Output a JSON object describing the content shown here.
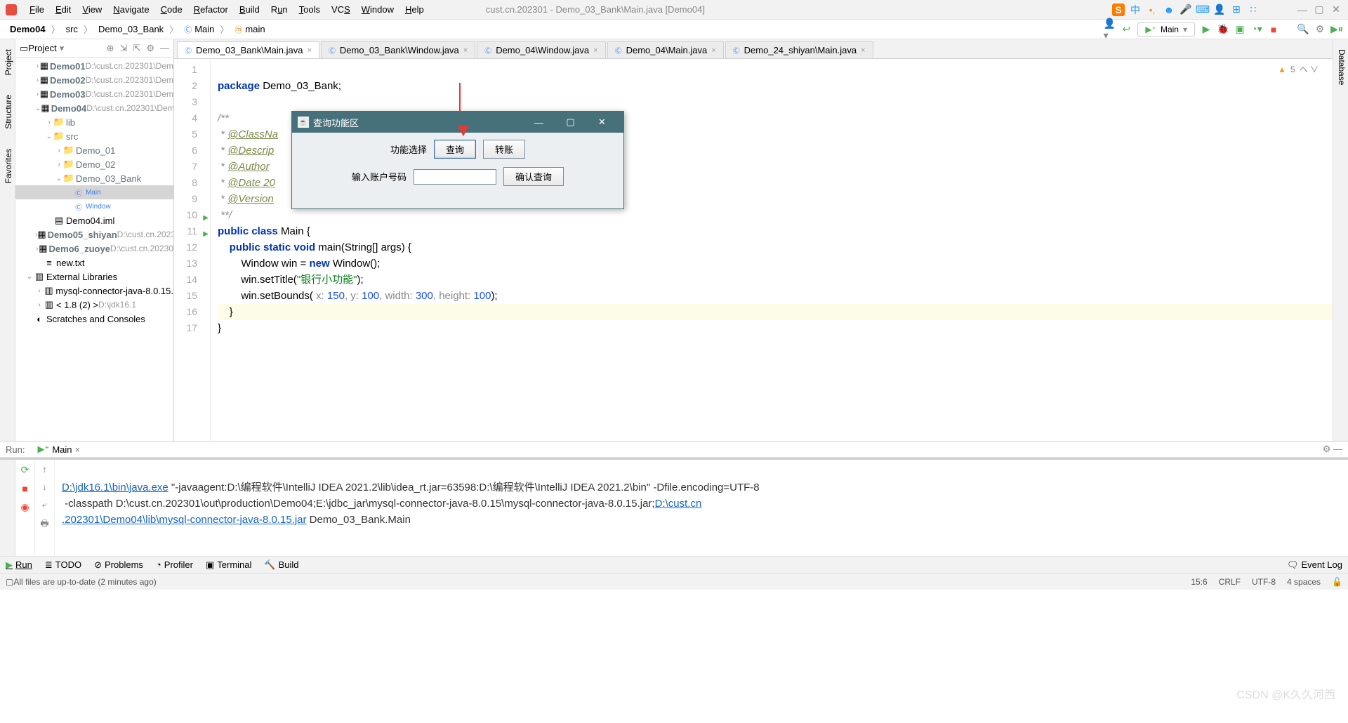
{
  "window": {
    "title": "cust.cn.202301 - Demo_03_Bank\\Main.java [Demo04]"
  },
  "menu": [
    "File",
    "Edit",
    "View",
    "Navigate",
    "Code",
    "Refactor",
    "Build",
    "Run",
    "Tools",
    "VCS",
    "Window",
    "Help"
  ],
  "breadcrumb": {
    "a": "Demo04",
    "b": "src",
    "c": "Demo_03_Bank",
    "d": "Main",
    "e": "main"
  },
  "runconfig": {
    "name": "Main"
  },
  "project": {
    "header": "Project",
    "items": [
      {
        "depth": 0,
        "tw": "›",
        "ic": "▦",
        "cls": "module bold",
        "label": "Demo01",
        "dim": "D:\\cust.cn.202301\\Dem"
      },
      {
        "depth": 0,
        "tw": "›",
        "ic": "▦",
        "cls": "module bold",
        "label": "Demo02",
        "dim": "D:\\cust.cn.202301\\Dem"
      },
      {
        "depth": 0,
        "tw": "›",
        "ic": "▦",
        "cls": "module bold",
        "label": "Demo03",
        "dim": "D:\\cust.cn.202301\\Dem"
      },
      {
        "depth": 0,
        "tw": "⌄",
        "ic": "▦",
        "cls": "module bold",
        "label": "Demo04",
        "dim": "D:\\cust.cn.202301\\Dem"
      },
      {
        "depth": 1,
        "tw": "›",
        "ic": "📁",
        "cls": "folder",
        "label": "lib"
      },
      {
        "depth": 1,
        "tw": "⌄",
        "ic": "📁",
        "cls": "folder",
        "label": "src"
      },
      {
        "depth": 2,
        "tw": "›",
        "ic": "📁",
        "cls": "folder",
        "label": "Demo_01"
      },
      {
        "depth": 2,
        "tw": "›",
        "ic": "📁",
        "cls": "folder",
        "label": "Demo_02"
      },
      {
        "depth": 2,
        "tw": "⌄",
        "ic": "📁",
        "cls": "folder",
        "label": "Demo_03_Bank"
      },
      {
        "depth": 3,
        "tw": "",
        "ic": "Ⓒ",
        "cls": "cfile",
        "label": "Main",
        "sel": true
      },
      {
        "depth": 3,
        "tw": "",
        "ic": "Ⓒ",
        "cls": "cfile",
        "label": "Window"
      },
      {
        "depth": 1,
        "tw": "",
        "ic": "▤",
        "cls": "",
        "label": "Demo04.iml"
      },
      {
        "depth": 0,
        "tw": "›",
        "ic": "▦",
        "cls": "module bold",
        "label": "Demo05_shiyan",
        "dim": "D:\\cust.cn.2023"
      },
      {
        "depth": 0,
        "tw": "›",
        "ic": "▦",
        "cls": "module bold",
        "label": "Demo6_zuoye",
        "dim": "D:\\cust.cn.20230"
      },
      {
        "depth": 0,
        "tw": "",
        "ic": "≡",
        "cls": "",
        "label": "new.txt"
      },
      {
        "depth": -1,
        "tw": "⌄",
        "ic": "▥",
        "cls": "",
        "label": "External Libraries"
      },
      {
        "depth": 0,
        "tw": "›",
        "ic": "▥",
        "cls": "",
        "label": "mysql-connector-java-8.0.15."
      },
      {
        "depth": 0,
        "tw": "›",
        "ic": "▥",
        "cls": "",
        "label": "< 1.8 (2) >",
        "dim": "D:\\jdk16.1"
      },
      {
        "depth": -1,
        "tw": "",
        "ic": "◐",
        "cls": "",
        "label": "Scratches and Consoles"
      }
    ]
  },
  "tabs": [
    {
      "label": "Demo_03_Bank\\Main.java",
      "active": true
    },
    {
      "label": "Demo_03_Bank\\Window.java"
    },
    {
      "label": "Demo_04\\Window.java"
    },
    {
      "label": "Demo_04\\Main.java"
    },
    {
      "label": "Demo_24_shiyan\\Main.java"
    }
  ],
  "code": {
    "l1": "package Demo_03_Bank;",
    "l3": "/**",
    "l4a": " * ",
    "l4b": "@ClassNa",
    "l5a": " * ",
    "l5b": "@Descrip",
    "l6a": " * ",
    "l6b": "@Author",
    "l7a": " * ",
    "l7b": "@Date 20",
    "l8a": " * ",
    "l8b": "@Version",
    "l9": " **/",
    "l10a": "public class ",
    "l10b": "Main {",
    "l11a": "    public static void ",
    "l11b": "main",
    "l11c": "(String[] args) {",
    "l12": "        Window win = new Window();",
    "l13a": "        win.setTitle(",
    "l13b": "\"银行小功能\"",
    "l13c": ");",
    "l14a": "        win.setBounds( ",
    "l14x": "x: ",
    "l14xv": "150",
    "l14y": ", y: ",
    "l14yv": "100",
    "l14w": ", width: ",
    "l14wv": "300",
    "l14h": ", height: ",
    "l14hv": "100",
    "l14e": ");",
    "l15": "    }",
    "l16": "}"
  },
  "inspections": {
    "warn": "5"
  },
  "dialog": {
    "title": "查询功能区",
    "row1_label": "功能选择",
    "btn_query": "查询",
    "btn_transfer": "转账",
    "row2_label": "输入账户号码",
    "btn_confirm": "确认查询"
  },
  "run": {
    "label": "Run:",
    "tab": "Main",
    "line1_link": "D:\\jdk16.1\\bin\\java.exe",
    "line1_rest": " \"-javaagent:D:\\编程软件\\IntelliJ IDEA 2021.2\\lib\\idea_rt.jar=63598:D:\\编程软件\\IntelliJ IDEA 2021.2\\bin\" -Dfile.encoding=UTF-8",
    "line2_pre": " -classpath D:\\cust.cn.202301\\out\\production\\Demo04;E:\\jdbc_jar\\mysql-connector-java-8.0.15\\mysql-connector-java-8.0.15.jar;",
    "line2_link": "D:\\cust.cn",
    "line3_link": ".202301\\Demo04\\lib\\mysql-connector-java-8.0.15.jar",
    "line3_rest": " Demo_03_Bank.Main"
  },
  "bottomtabs": {
    "run": "Run",
    "todo": "TODO",
    "problems": "Problems",
    "profiler": "Profiler",
    "terminal": "Terminal",
    "build": "Build",
    "eventlog": "Event Log"
  },
  "status": {
    "msg": "All files are up-to-date (2 minutes ago)",
    "pos": "15:6",
    "le": "CRLF",
    "enc": "UTF-8",
    "indent": "4 spaces"
  },
  "sidetabs": {
    "project": "Project",
    "structure": "Structure",
    "favorites": "Favorites",
    "database": "Database"
  },
  "watermark": "CSDN @K久久河西"
}
